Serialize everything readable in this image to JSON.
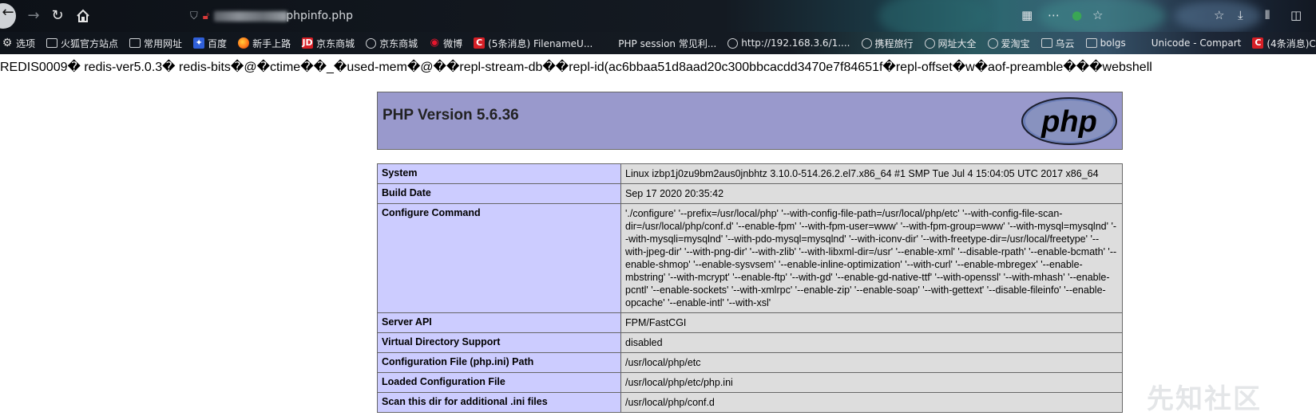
{
  "browser": {
    "url_visible": "phpinfo.php"
  },
  "bookmarks": [
    {
      "label": "选项",
      "icon": "gear-icon"
    },
    {
      "label": "火狐官方站点",
      "icon": "folder-icon"
    },
    {
      "label": "常用网址",
      "icon": "folder-icon"
    },
    {
      "label": "百度",
      "icon": "baidu-icon"
    },
    {
      "label": "新手上路",
      "icon": "firefox-icon"
    },
    {
      "label": "京东商城",
      "icon": "jd-icon"
    },
    {
      "label": "京东商城",
      "icon": "globe-icon"
    },
    {
      "label": "微博",
      "icon": "weibo-icon"
    },
    {
      "label": "(5条消息) FilenameU...",
      "icon": "csdn-icon"
    },
    {
      "label": "PHP session 常见利...",
      "icon": "page-icon"
    },
    {
      "label": "http://192.168.3.6/1....",
      "icon": "globe-icon"
    },
    {
      "label": "携程旅行",
      "icon": "globe-icon"
    },
    {
      "label": "网址大全",
      "icon": "globe-icon"
    },
    {
      "label": "爱淘宝",
      "icon": "globe-icon"
    },
    {
      "label": "乌云",
      "icon": "folder-icon"
    },
    {
      "label": "bolgs",
      "icon": "folder-icon"
    },
    {
      "label": "Unicode - Compart",
      "icon": "page-icon"
    },
    {
      "label": "(4条消息)C",
      "icon": "csdn-icon"
    }
  ],
  "page": {
    "redis_line": "REDIS0009� redis-ver5.0.3� redis-bits�@�ctime��_�used-mem�@��repl-stream-db��repl-id(ac6bbaa51d8aad20c300bbcacdd3470e7f84651f�repl-offset�w�aof-preamble���webshell",
    "php_version_title": "PHP Version 5.6.36",
    "php_logo_text": "php",
    "rows": [
      {
        "key": "System",
        "value": "Linux izbp1j0zu9bm2aus0jnbhtz 3.10.0-514.26.2.el7.x86_64 #1 SMP Tue Jul 4 15:04:05 UTC 2017 x86_64"
      },
      {
        "key": "Build Date",
        "value": "Sep 17 2020 20:35:42"
      },
      {
        "key": "Configure Command",
        "value": "'./configure' '--prefix=/usr/local/php' '--with-config-file-path=/usr/local/php/etc' '--with-config-file-scan-dir=/usr/local/php/conf.d' '--enable-fpm' '--with-fpm-user=www' '--with-fpm-group=www' '--with-mysql=mysqlnd' '--with-mysqli=mysqlnd' '--with-pdo-mysql=mysqlnd' '--with-iconv-dir' '--with-freetype-dir=/usr/local/freetype' '--with-jpeg-dir' '--with-png-dir' '--with-zlib' '--with-libxml-dir=/usr' '--enable-xml' '--disable-rpath' '--enable-bcmath' '--enable-shmop' '--enable-sysvsem' '--enable-inline-optimization' '--with-curl' '--enable-mbregex' '--enable-mbstring' '--with-mcrypt' '--enable-ftp' '--with-gd' '--enable-gd-native-ttf' '--with-openssl' '--with-mhash' '--enable-pcntl' '--enable-sockets' '--with-xmlrpc' '--enable-zip' '--enable-soap' '--with-gettext' '--disable-fileinfo' '--enable-opcache' '--enable-intl' '--with-xsl'"
      },
      {
        "key": "Server API",
        "value": "FPM/FastCGI"
      },
      {
        "key": "Virtual Directory Support",
        "value": "disabled"
      },
      {
        "key": "Configuration File (php.ini) Path",
        "value": "/usr/local/php/etc"
      },
      {
        "key": "Loaded Configuration File",
        "value": "/usr/local/php/etc/php.ini"
      },
      {
        "key": "Scan this dir for additional .ini files",
        "value": "/usr/local/php/conf.d"
      }
    ]
  },
  "watermark": "先知社区",
  "colors": {
    "php_header_bg": "#9999cc",
    "key_cell_bg": "#ccccff",
    "value_cell_bg": "#dddddd"
  }
}
